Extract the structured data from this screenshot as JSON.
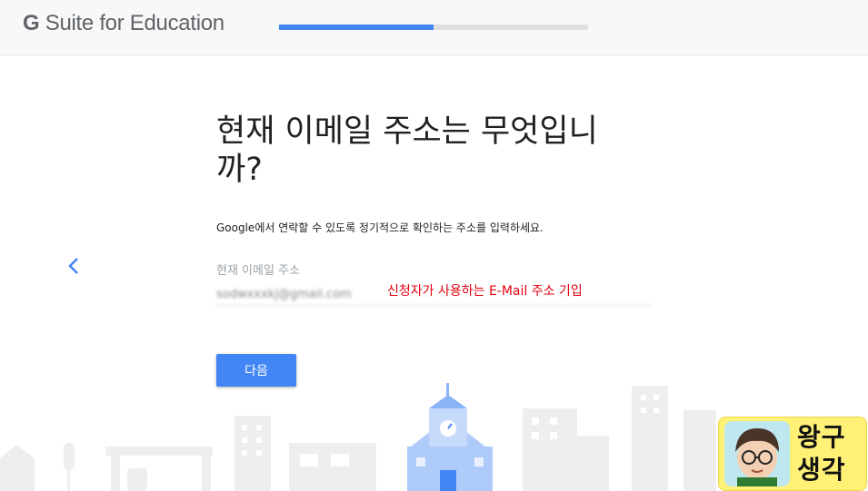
{
  "header": {
    "logo_g": "G",
    "logo_text": " Suite for Education",
    "progress_fraction": 0.5
  },
  "main": {
    "heading": "현재 이메일 주소는 무엇입니까?",
    "subtitle": "Google에서 연락할 수 있도록 정기적으로 확인하는 주소를 입력하세요.",
    "email_label": "현재 이메일 주소",
    "email_value": "sodwxxxkj@gmail.com",
    "annotation": "신청자가 사용하는 E-Mail 주소 기입",
    "next_label": "다음"
  },
  "badge": {
    "line1": "왕구",
    "line2": "생각"
  },
  "colors": {
    "accent": "#4285f4",
    "annotation": "#e3000f",
    "badge_bg": "#fff176"
  },
  "icons": {
    "back": "chevron-left-icon"
  }
}
